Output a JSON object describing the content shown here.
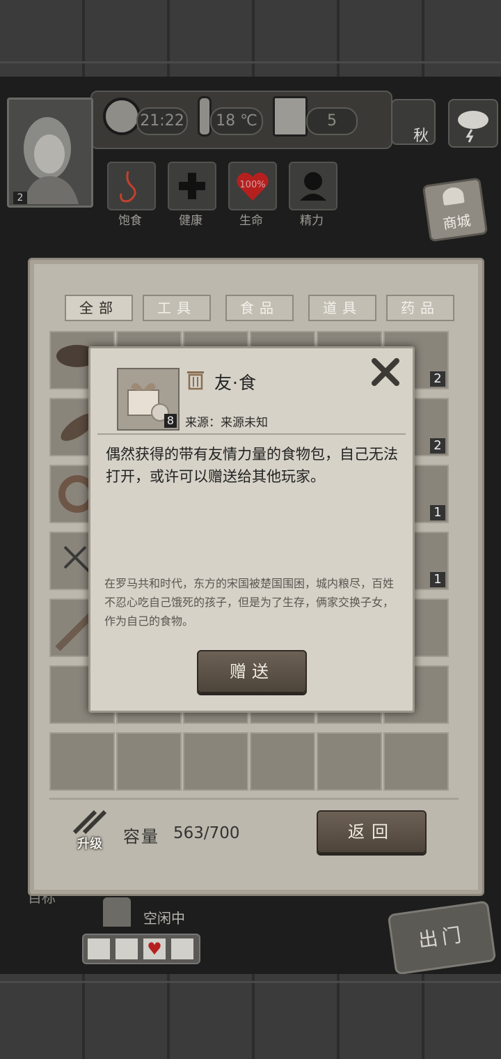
{
  "hud": {
    "avatar_level": "2",
    "time": "21:22",
    "temperature": "18 ℃",
    "day": "5",
    "season": "秋",
    "shop": "商城",
    "stats": [
      {
        "label": "饱食",
        "icon": "stomach-icon"
      },
      {
        "label": "健康",
        "icon": "health-cross-icon"
      },
      {
        "label": "生命",
        "icon": "heart-icon",
        "value": "100%"
      },
      {
        "label": "精力",
        "icon": "energy-person-icon"
      }
    ]
  },
  "inventory": {
    "tabs": [
      "全部",
      "工具",
      "食品",
      "道具",
      "药品"
    ],
    "active_tab": "全部",
    "counts": {
      "r1": "2",
      "r2": "2",
      "r3": "1",
      "r4": "1"
    },
    "upgrade": "升级",
    "capacity_label": "容量",
    "capacity_value": "563/700",
    "back_button": "返回"
  },
  "popup": {
    "item_name": "友·食",
    "item_count": "8",
    "source": "来源：来源未知",
    "description": "偶然获得的带有友情力量的食物包，自己无法打开，或许可以赠送给其他玩家。",
    "lore": "在罗马共和时代，东方的宋国被楚国围困，城内粮尽，百姓不忍心吃自己饿死的孩子，但是为了生存，俩家交换子女，作为自己的食物。",
    "gift_button": "赠送"
  },
  "footer": {
    "goal_label": "目标",
    "status": "空闲中",
    "exit_button": "出门"
  },
  "colors": {
    "paper": "#bdb8ad",
    "popup": "#d6d2c8",
    "wood": "#3b3b3b"
  }
}
